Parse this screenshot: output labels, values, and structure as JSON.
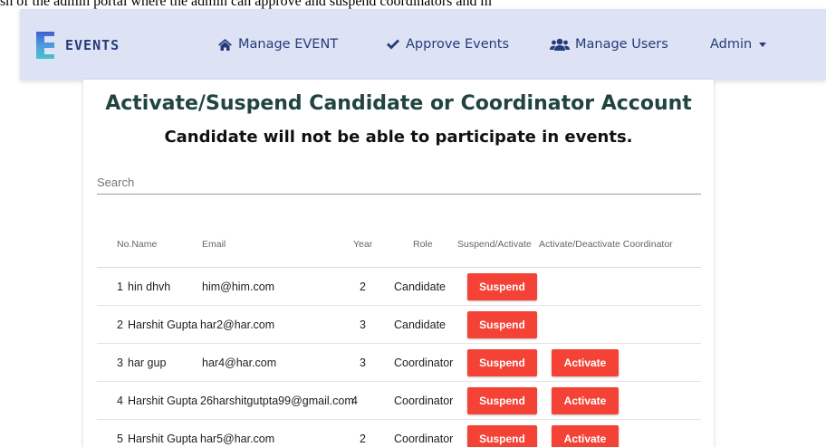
{
  "caption": "sh of the admin portal where the admin can approve and suspend coordinators and m",
  "navbar": {
    "brand": "EVENTS",
    "items": [
      {
        "label": "Manage EVENT",
        "icon": "home-icon"
      },
      {
        "label": "Approve Events",
        "icon": "check-icon"
      },
      {
        "label": "Manage Users",
        "icon": "users-icon"
      }
    ],
    "admin_label": "Admin",
    "text_color": "#253c7a",
    "background": "#dde3f4"
  },
  "page": {
    "title": "Activate/Suspend Candidate or Coordinator Account",
    "subtitle": "Candidate will not be able to participate in events.",
    "search_placeholder": "Search"
  },
  "table": {
    "headers": {
      "no_name": "No.Name",
      "email": "Email",
      "year": "Year",
      "role": "Role",
      "suspend_activate": "Suspend/Activate",
      "activate_deactivate": "Activate/Deactivate Coordinator"
    },
    "rows": [
      {
        "no": "1",
        "name": "hin dhvh",
        "email": "him@him.com",
        "year": "2",
        "role": "Candidate",
        "suspend_label": "Suspend",
        "activate_label": ""
      },
      {
        "no": "2",
        "name": "Harshit Gupta",
        "email": "har2@har.com",
        "year": "3",
        "role": "Candidate",
        "suspend_label": "Suspend",
        "activate_label": ""
      },
      {
        "no": "3",
        "name": "har gup",
        "email": "har4@har.com",
        "year": "3",
        "role": "Coordinator",
        "suspend_label": "Suspend",
        "activate_label": "Activate"
      },
      {
        "no": "4",
        "name": "Harshit Gupta",
        "email": "26harshitgutpta99@gmail.com",
        "year": "4",
        "role": "Coordinator",
        "suspend_label": "Suspend",
        "activate_label": "Activate"
      },
      {
        "no": "5",
        "name": "Harshit Gupta",
        "email": "har5@har.com",
        "year": "2",
        "role": "Coordinator",
        "suspend_label": "Suspend",
        "activate_label": "Activate"
      }
    ]
  },
  "colors": {
    "title": "#21453e",
    "button": "#f44336"
  }
}
